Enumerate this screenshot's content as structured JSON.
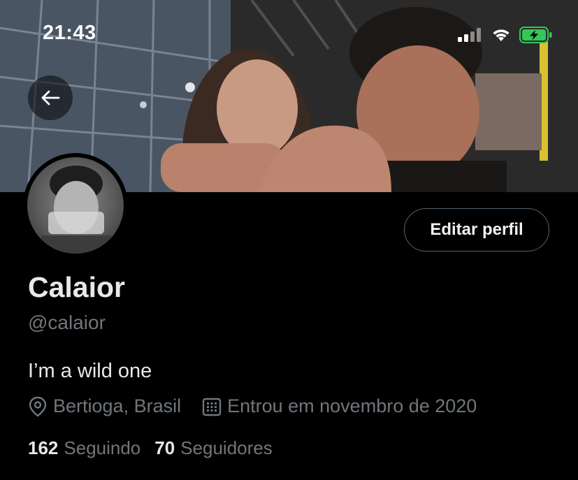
{
  "status_bar": {
    "time": "21:43",
    "signal_icon": "cellular-signal-icon",
    "wifi_icon": "wifi-icon",
    "battery_icon": "battery-charging-icon",
    "battery_color": "#34c759"
  },
  "header": {
    "back_icon": "back-arrow-icon"
  },
  "profile": {
    "edit_button_label": "Editar perfil",
    "display_name": "Calaior",
    "handle": "@calaior",
    "bio": "I’m a wild one",
    "location": "Bertioga, Brasil",
    "location_icon": "location-pin-icon",
    "joined": "Entrou em novembro de 2020",
    "joined_icon": "calendar-icon",
    "following_count": "162",
    "following_label": "Seguindo",
    "followers_count": "70",
    "followers_label": "Seguidores"
  },
  "colors": {
    "background": "#000000",
    "primary_text": "#e7e9ea",
    "secondary_text": "#71767b",
    "button_border": "#536471"
  }
}
